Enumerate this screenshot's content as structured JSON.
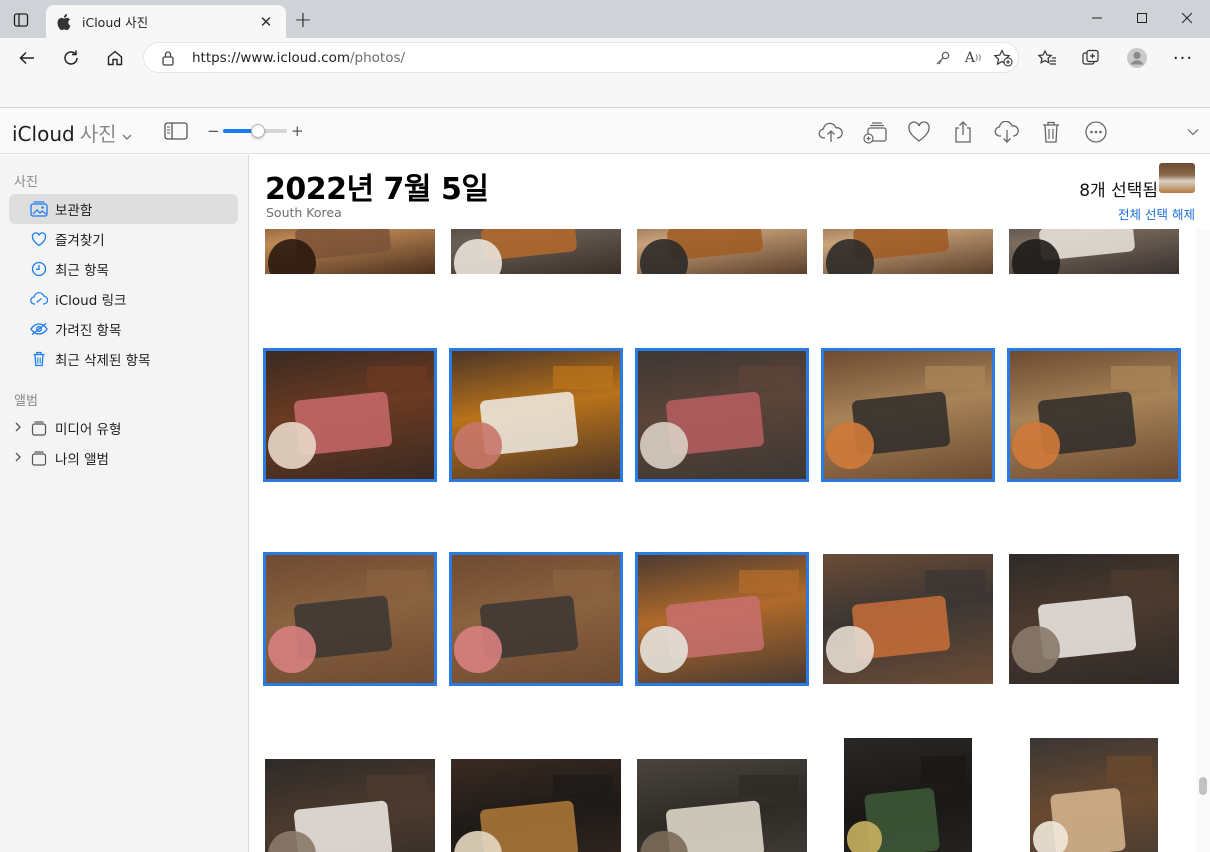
{
  "browser": {
    "tab_title": "iCloud 사진",
    "url_host": "https://www.icloud.com",
    "url_path": "/photos/"
  },
  "app": {
    "brand": "iCloud",
    "brand_sub": "사진",
    "zoom_level": 0.55
  },
  "sidebar": {
    "photos_section": "사진",
    "items": [
      {
        "label": "보관함",
        "icon": "library-icon",
        "active": true
      },
      {
        "label": "즐겨찾기",
        "icon": "heart-icon"
      },
      {
        "label": "최근 항목",
        "icon": "clock-icon"
      },
      {
        "label": "iCloud 링크",
        "icon": "link-icon"
      },
      {
        "label": "가려진 항목",
        "icon": "eye-hidden-icon"
      },
      {
        "label": "최근 삭제된 항목",
        "icon": "trash-icon"
      }
    ],
    "albums_section": "앨범",
    "albums": [
      {
        "label": "미디어 유형",
        "icon": "album-stack-icon"
      },
      {
        "label": "나의 앨범",
        "icon": "album-stack-icon"
      }
    ]
  },
  "main": {
    "date": "2022년 7월 5일",
    "place": "South Korea",
    "selected_count": "8개 선택됨",
    "deselect_all": "전체 선택 해제"
  },
  "colors": {
    "accent": "#1a7cf5",
    "selection": "#2a7ae2",
    "link": "#1a6fd6"
  },
  "photos": [
    {
      "row": 0,
      "col": 0,
      "selected": false,
      "subject": "wooden sign"
    },
    {
      "row": 0,
      "col": 1,
      "selected": false,
      "subject": "tonkatsu and rice"
    },
    {
      "row": 0,
      "col": 2,
      "selected": false,
      "subject": "tonkatsu plate"
    },
    {
      "row": 0,
      "col": 3,
      "selected": false,
      "subject": "tonkatsu plate"
    },
    {
      "row": 0,
      "col": 4,
      "selected": false,
      "subject": "rice bowl"
    },
    {
      "row": 1,
      "col": 0,
      "selected": true,
      "subject": "sliced beef with miso soup"
    },
    {
      "row": 1,
      "col": 1,
      "selected": true,
      "subject": "beef set with rice and soup"
    },
    {
      "row": 1,
      "col": 2,
      "selected": true,
      "subject": "sliced beef and sauces"
    },
    {
      "row": 1,
      "col": 3,
      "selected": true,
      "subject": "tonkatsu on grill stone"
    },
    {
      "row": 1,
      "col": 4,
      "selected": true,
      "subject": "tonkatsu on grill stone"
    },
    {
      "row": 2,
      "col": 0,
      "selected": true,
      "subject": "beef on grill stone"
    },
    {
      "row": 2,
      "col": 1,
      "selected": true,
      "subject": "beef on grill stone"
    },
    {
      "row": 2,
      "col": 2,
      "selected": true,
      "subject": "beef set overhead"
    },
    {
      "row": 2,
      "col": 3,
      "selected": false,
      "subject": "full meal table"
    },
    {
      "row": 2,
      "col": 4,
      "selected": false,
      "subject": "menu clipboard"
    },
    {
      "row": 3,
      "col": 0,
      "selected": false,
      "subject": "menu clipboard"
    },
    {
      "row": 3,
      "col": 1,
      "selected": false,
      "subject": "cafe counter"
    },
    {
      "row": 3,
      "col": 2,
      "selected": false,
      "subject": "cafe interior"
    },
    {
      "row": 3,
      "col": 3,
      "selected": false,
      "subject": "christmas tree"
    },
    {
      "row": 3,
      "col": 4,
      "selected": false,
      "subject": "latte overhead"
    }
  ]
}
